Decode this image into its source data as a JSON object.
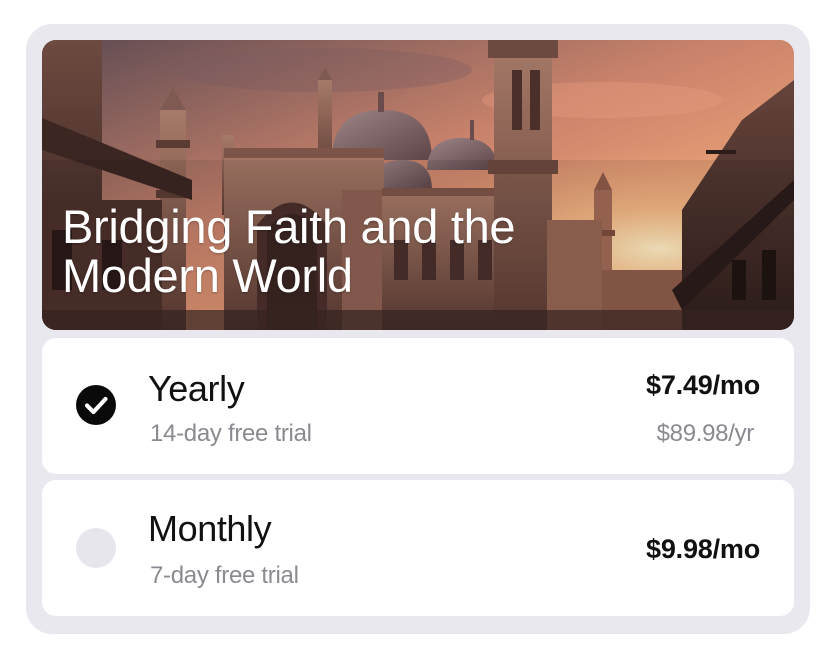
{
  "hero": {
    "title": "Bridging Faith and the Modern World"
  },
  "plans": [
    {
      "name": "Yearly",
      "trial": "14-day free trial",
      "price": "$7.49/mo",
      "annual": "$89.98/yr",
      "selected": true,
      "icon": "check-icon"
    },
    {
      "name": "Monthly",
      "trial": "7-day free trial",
      "price": "$9.98/mo",
      "selected": false
    }
  ],
  "colors": {
    "frame": "#e8e8ee",
    "card": "#ffffff",
    "selected_radio": "#0a0a0a",
    "unselected_radio": "#e6e6ec",
    "muted_text": "#8a8a90"
  }
}
